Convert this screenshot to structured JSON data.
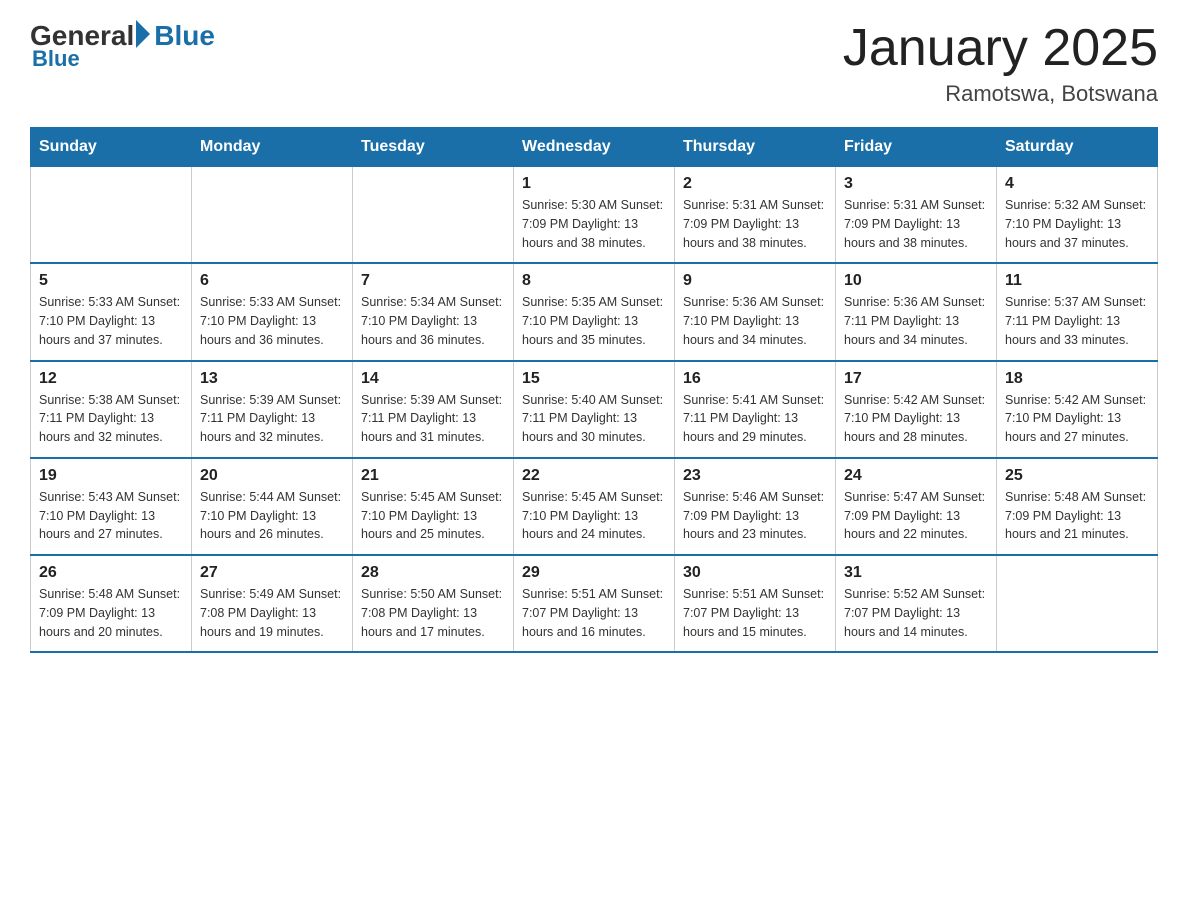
{
  "logo": {
    "general": "General",
    "blue": "Blue"
  },
  "title": "January 2025",
  "subtitle": "Ramotswa, Botswana",
  "days_of_week": [
    "Sunday",
    "Monday",
    "Tuesday",
    "Wednesday",
    "Thursday",
    "Friday",
    "Saturday"
  ],
  "weeks": [
    [
      {
        "day": "",
        "info": ""
      },
      {
        "day": "",
        "info": ""
      },
      {
        "day": "",
        "info": ""
      },
      {
        "day": "1",
        "info": "Sunrise: 5:30 AM\nSunset: 7:09 PM\nDaylight: 13 hours\nand 38 minutes."
      },
      {
        "day": "2",
        "info": "Sunrise: 5:31 AM\nSunset: 7:09 PM\nDaylight: 13 hours\nand 38 minutes."
      },
      {
        "day": "3",
        "info": "Sunrise: 5:31 AM\nSunset: 7:09 PM\nDaylight: 13 hours\nand 38 minutes."
      },
      {
        "day": "4",
        "info": "Sunrise: 5:32 AM\nSunset: 7:10 PM\nDaylight: 13 hours\nand 37 minutes."
      }
    ],
    [
      {
        "day": "5",
        "info": "Sunrise: 5:33 AM\nSunset: 7:10 PM\nDaylight: 13 hours\nand 37 minutes."
      },
      {
        "day": "6",
        "info": "Sunrise: 5:33 AM\nSunset: 7:10 PM\nDaylight: 13 hours\nand 36 minutes."
      },
      {
        "day": "7",
        "info": "Sunrise: 5:34 AM\nSunset: 7:10 PM\nDaylight: 13 hours\nand 36 minutes."
      },
      {
        "day": "8",
        "info": "Sunrise: 5:35 AM\nSunset: 7:10 PM\nDaylight: 13 hours\nand 35 minutes."
      },
      {
        "day": "9",
        "info": "Sunrise: 5:36 AM\nSunset: 7:10 PM\nDaylight: 13 hours\nand 34 minutes."
      },
      {
        "day": "10",
        "info": "Sunrise: 5:36 AM\nSunset: 7:11 PM\nDaylight: 13 hours\nand 34 minutes."
      },
      {
        "day": "11",
        "info": "Sunrise: 5:37 AM\nSunset: 7:11 PM\nDaylight: 13 hours\nand 33 minutes."
      }
    ],
    [
      {
        "day": "12",
        "info": "Sunrise: 5:38 AM\nSunset: 7:11 PM\nDaylight: 13 hours\nand 32 minutes."
      },
      {
        "day": "13",
        "info": "Sunrise: 5:39 AM\nSunset: 7:11 PM\nDaylight: 13 hours\nand 32 minutes."
      },
      {
        "day": "14",
        "info": "Sunrise: 5:39 AM\nSunset: 7:11 PM\nDaylight: 13 hours\nand 31 minutes."
      },
      {
        "day": "15",
        "info": "Sunrise: 5:40 AM\nSunset: 7:11 PM\nDaylight: 13 hours\nand 30 minutes."
      },
      {
        "day": "16",
        "info": "Sunrise: 5:41 AM\nSunset: 7:11 PM\nDaylight: 13 hours\nand 29 minutes."
      },
      {
        "day": "17",
        "info": "Sunrise: 5:42 AM\nSunset: 7:10 PM\nDaylight: 13 hours\nand 28 minutes."
      },
      {
        "day": "18",
        "info": "Sunrise: 5:42 AM\nSunset: 7:10 PM\nDaylight: 13 hours\nand 27 minutes."
      }
    ],
    [
      {
        "day": "19",
        "info": "Sunrise: 5:43 AM\nSunset: 7:10 PM\nDaylight: 13 hours\nand 27 minutes."
      },
      {
        "day": "20",
        "info": "Sunrise: 5:44 AM\nSunset: 7:10 PM\nDaylight: 13 hours\nand 26 minutes."
      },
      {
        "day": "21",
        "info": "Sunrise: 5:45 AM\nSunset: 7:10 PM\nDaylight: 13 hours\nand 25 minutes."
      },
      {
        "day": "22",
        "info": "Sunrise: 5:45 AM\nSunset: 7:10 PM\nDaylight: 13 hours\nand 24 minutes."
      },
      {
        "day": "23",
        "info": "Sunrise: 5:46 AM\nSunset: 7:09 PM\nDaylight: 13 hours\nand 23 minutes."
      },
      {
        "day": "24",
        "info": "Sunrise: 5:47 AM\nSunset: 7:09 PM\nDaylight: 13 hours\nand 22 minutes."
      },
      {
        "day": "25",
        "info": "Sunrise: 5:48 AM\nSunset: 7:09 PM\nDaylight: 13 hours\nand 21 minutes."
      }
    ],
    [
      {
        "day": "26",
        "info": "Sunrise: 5:48 AM\nSunset: 7:09 PM\nDaylight: 13 hours\nand 20 minutes."
      },
      {
        "day": "27",
        "info": "Sunrise: 5:49 AM\nSunset: 7:08 PM\nDaylight: 13 hours\nand 19 minutes."
      },
      {
        "day": "28",
        "info": "Sunrise: 5:50 AM\nSunset: 7:08 PM\nDaylight: 13 hours\nand 17 minutes."
      },
      {
        "day": "29",
        "info": "Sunrise: 5:51 AM\nSunset: 7:07 PM\nDaylight: 13 hours\nand 16 minutes."
      },
      {
        "day": "30",
        "info": "Sunrise: 5:51 AM\nSunset: 7:07 PM\nDaylight: 13 hours\nand 15 minutes."
      },
      {
        "day": "31",
        "info": "Sunrise: 5:52 AM\nSunset: 7:07 PM\nDaylight: 13 hours\nand 14 minutes."
      },
      {
        "day": "",
        "info": ""
      }
    ]
  ]
}
